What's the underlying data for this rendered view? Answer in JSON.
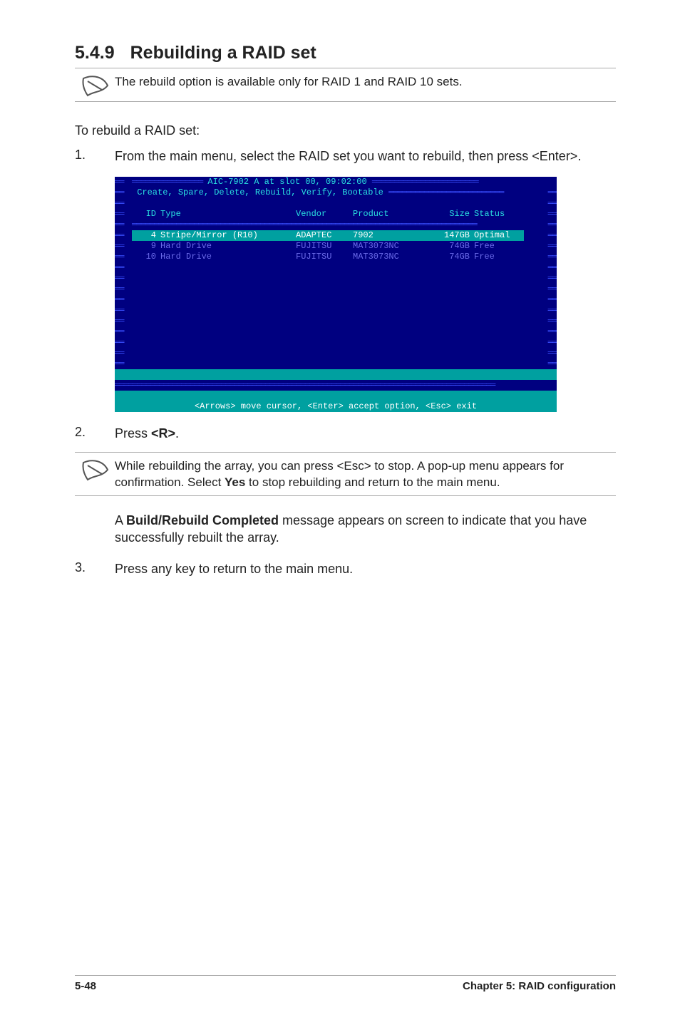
{
  "heading": {
    "number": "5.4.9",
    "title": "Rebuilding a RAID set"
  },
  "note1": "The rebuild option is available only for RAID 1 and RAID 10 sets.",
  "intro": "To rebuild a RAID set:",
  "steps": {
    "s1": {
      "num": "1.",
      "text": "From the main menu, select the RAID set you want to rebuild, then press <Enter>."
    },
    "s2": {
      "num": "2.",
      "prefix": "Press ",
      "key": "<R>",
      "suffix": "."
    },
    "s3": {
      "num": "3.",
      "text": "Press any key to return to the main menu."
    }
  },
  "note2": {
    "a": "While rebuilding the array, you can press <Esc> to stop. A pop-up menu appears for confirmation. Select ",
    "yes": "Yes",
    "b": " to stop rebuilding and return to the main menu."
  },
  "result": {
    "a": "A ",
    "bold": "Build/Rebuild Completed",
    "b": " message appears on screen to indicate that you have successfully rebuilt the array."
  },
  "bios": {
    "title_a": "AIC-7902 A at slot 00, 09:02:00",
    "menu": "Create, Spare, Delete, Rebuild, Verify, Bootable",
    "headers": {
      "id": "ID",
      "type": "Type",
      "vendor": "Vendor",
      "product": "Product",
      "size": "Size",
      "status": "Status"
    },
    "rows": [
      {
        "id": "4",
        "type": "Stripe/Mirror (R10)",
        "vendor": "ADAPTEC",
        "product": "7902",
        "size": "147GB",
        "status": "Optimal",
        "hl": true
      },
      {
        "id": "9",
        "type": "Hard Drive",
        "vendor": "FUJITSU",
        "product": "MAT3073NC",
        "size": "74GB",
        "status": "Free",
        "hl": false
      },
      {
        "id": "10",
        "type": "Hard Drive",
        "vendor": "FUJITSU",
        "product": "MAT3073NC",
        "size": "74GB",
        "status": "Free",
        "hl": false
      }
    ],
    "hint": "<Arrows> move cursor, <Enter> accept option, <Esc> exit"
  },
  "footer": {
    "left": "5-48",
    "right": "Chapter 5: RAID configuration"
  }
}
